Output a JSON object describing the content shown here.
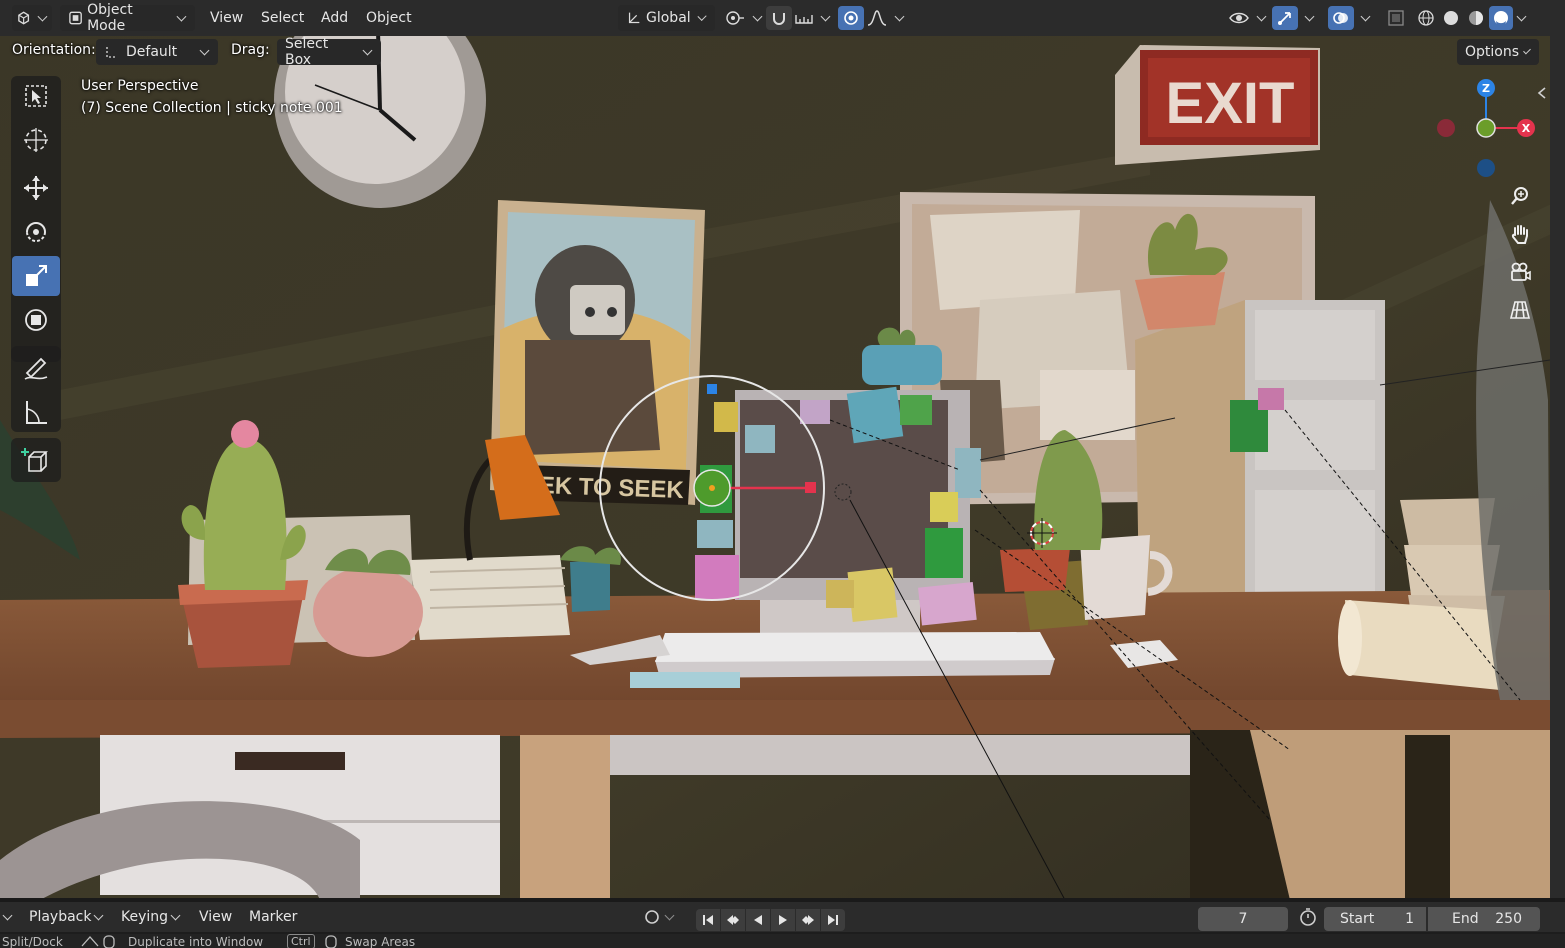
{
  "header": {
    "mode_label": "Object Mode",
    "menu": [
      "View",
      "Select",
      "Add",
      "Object"
    ],
    "transform_space": "Global",
    "options_label": "Options"
  },
  "subheader": {
    "orientation_label": "Orientation:",
    "orientation_value": "Default",
    "drag_label": "Drag:",
    "drag_value": "Select Box"
  },
  "viewport": {
    "view_name": "User Perspective",
    "collection_info": "(7) Scene Collection | sticky note.001",
    "gizmo_axes": {
      "z": "Z",
      "x": "X"
    },
    "scene_text": {
      "exit_sign": "EXIT",
      "poster_caption": "SEEK TO SEEK"
    },
    "toolbar": [
      {
        "name": "select-box",
        "active": false
      },
      {
        "name": "cursor",
        "active": false
      },
      {
        "name": "move",
        "active": false
      },
      {
        "name": "rotate",
        "active": false
      },
      {
        "name": "scale",
        "active": true
      },
      {
        "name": "transform",
        "active": false
      },
      {
        "name": "annotate",
        "active": false
      },
      {
        "name": "measure",
        "active": false
      },
      {
        "name": "add-cube",
        "active": false
      }
    ]
  },
  "timeline": {
    "menu": [
      "Playback",
      "Keying",
      "View",
      "Marker"
    ],
    "current_frame": "7",
    "start_label": "Start",
    "start_value": "1",
    "end_label": "End",
    "end_value": "250"
  },
  "status_bar": {
    "items": [
      "Split/Dock",
      "Duplicate into Window",
      "Ctrl",
      "Swap Areas"
    ]
  },
  "colors": {
    "accent": "#4772b3",
    "header_bg": "#2b2b2b",
    "axis_x": "#d7374f",
    "axis_y": "#6b9d2a",
    "axis_z": "#2f7fd6",
    "wall": "#3a3525"
  }
}
